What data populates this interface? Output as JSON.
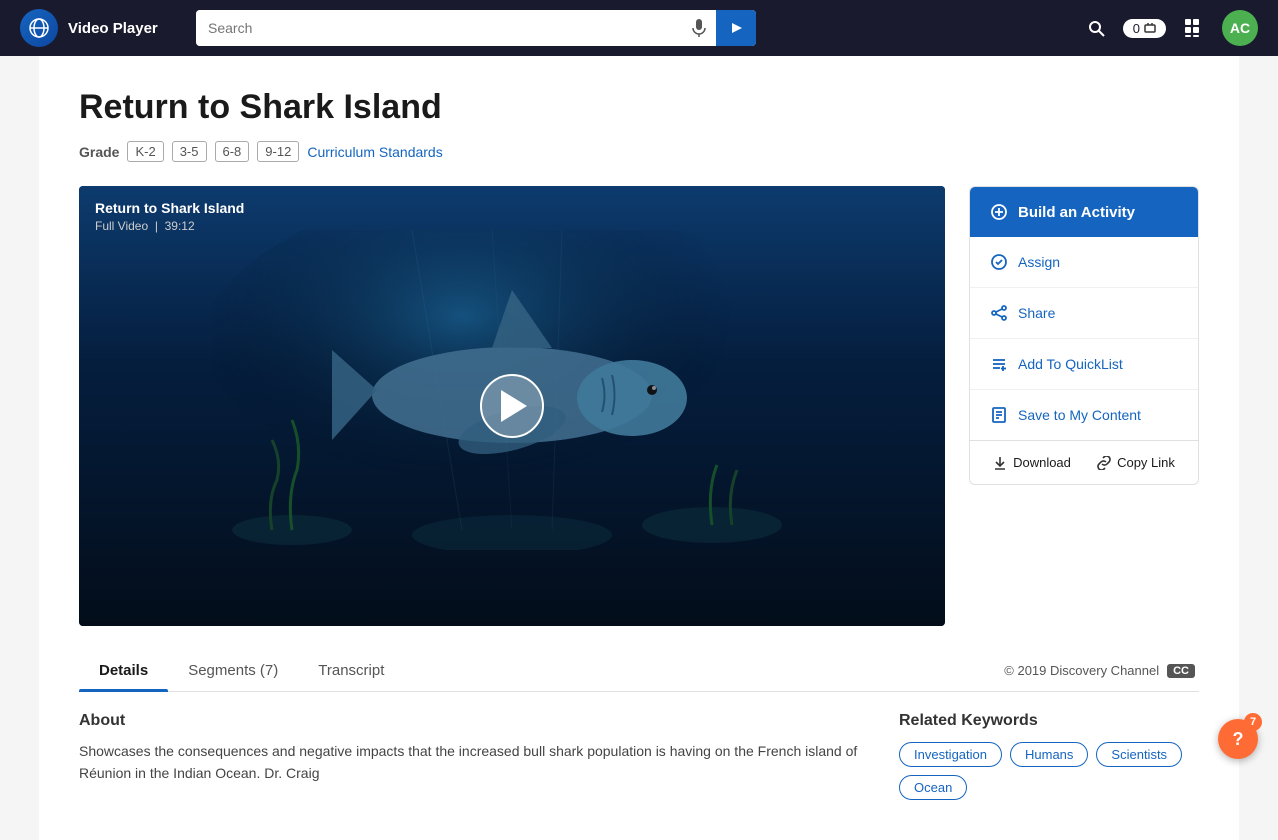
{
  "header": {
    "logo_text": "Video Player",
    "search_placeholder": "Search",
    "badge_count": "0",
    "avatar_initials": "AC"
  },
  "page": {
    "title": "Return to Shark Island",
    "grade_label": "Grade",
    "grades": [
      "K-2",
      "3-5",
      "6-8",
      "9-12"
    ],
    "curriculum_link": "Curriculum Standards"
  },
  "video": {
    "title": "Return to Shark Island",
    "subtitle": "Full Video",
    "duration": "39:12"
  },
  "sidebar": {
    "build_activity": "Build an Activity",
    "assign": "Assign",
    "share": "Share",
    "add_to_quicklist": "Add To QuickList",
    "save_to_content": "Save to My Content",
    "download": "Download",
    "copy_link": "Copy Link"
  },
  "tabs": [
    {
      "label": "Details",
      "active": true
    },
    {
      "label": "Segments (7)",
      "active": false
    },
    {
      "label": "Transcript",
      "active": false
    }
  ],
  "copyright": "© 2019 Discovery Channel",
  "cc_label": "CC",
  "about": {
    "heading": "About",
    "text": "Showcases the consequences and negative impacts that the increased bull shark population is having on the French island of Réunion in the Indian Ocean. Dr. Craig"
  },
  "keywords": {
    "heading": "Related Keywords",
    "tags": [
      "Investigation",
      "Humans",
      "Scientists",
      "Ocean"
    ]
  },
  "help": {
    "badge_count": "7",
    "symbol": "?"
  }
}
